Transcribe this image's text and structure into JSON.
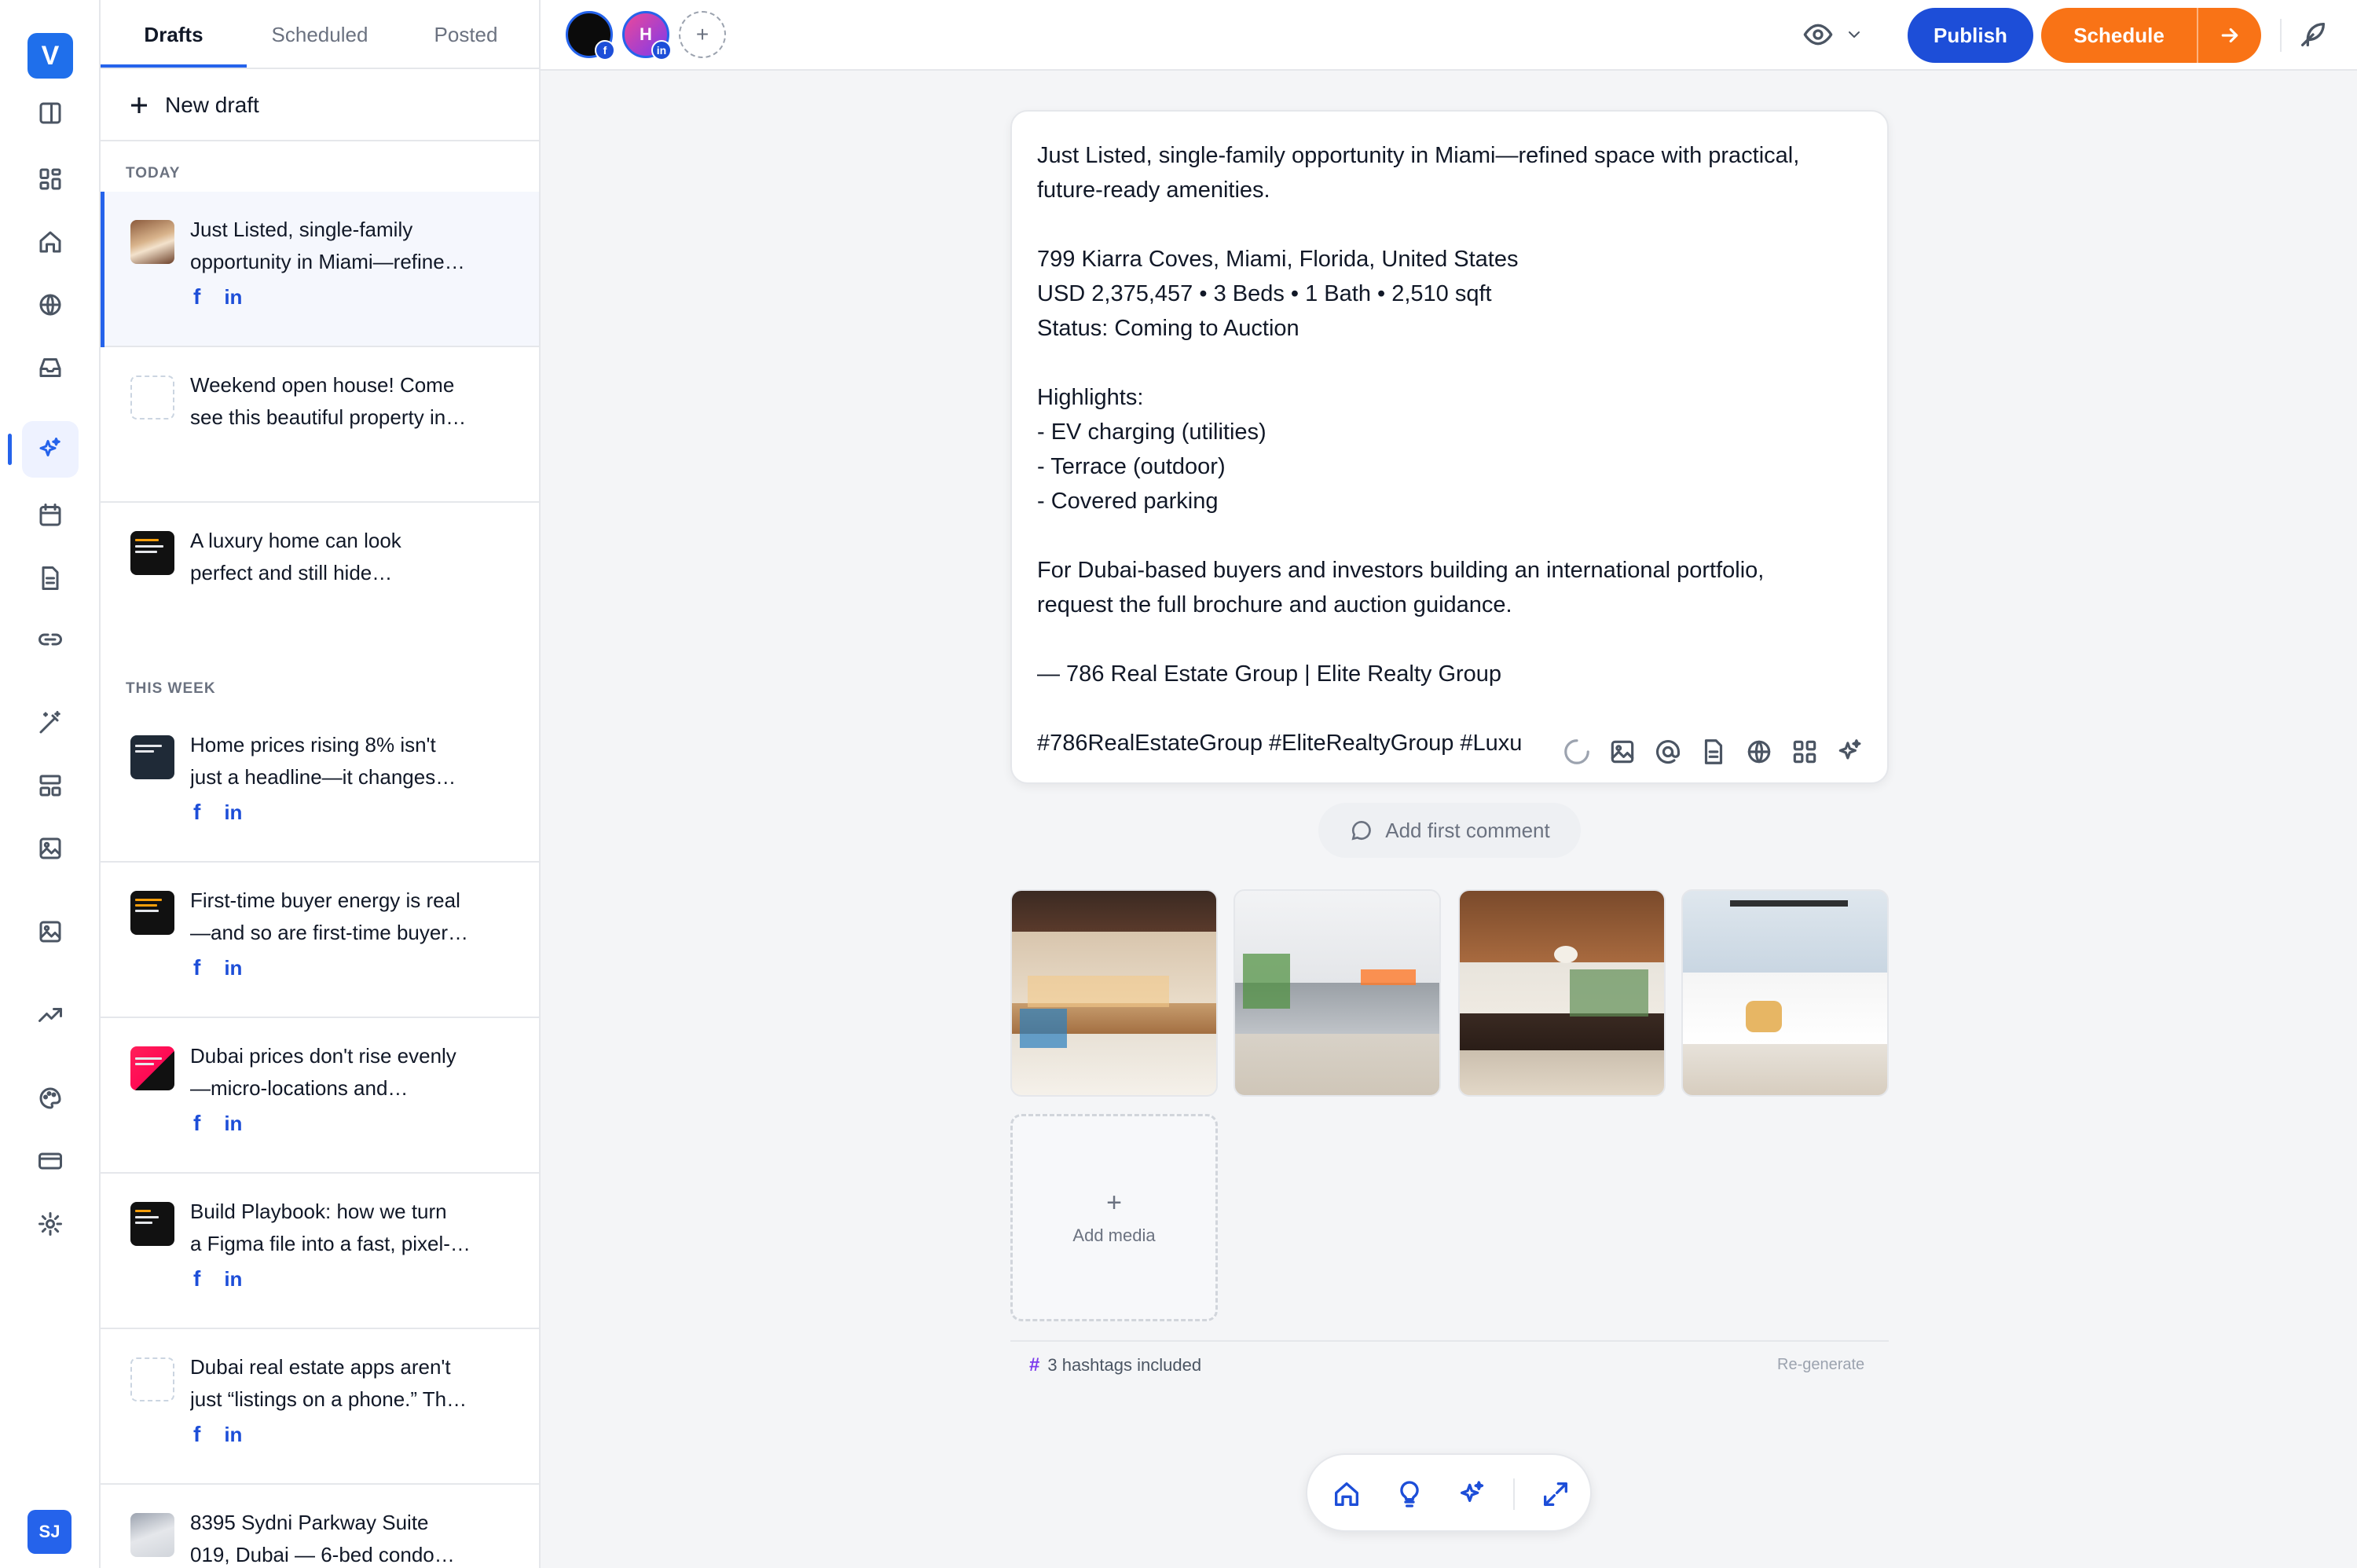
{
  "brand": {
    "logo_letter": "V",
    "accent": "#1d4ed8",
    "schedule_color": "#f97316"
  },
  "user": {
    "initials": "SJ"
  },
  "rail": {
    "icons": [
      "sidebar-toggle-icon",
      "dashboard-icon",
      "home-icon",
      "globe-icon",
      "inbox-icon",
      "sparkles-icon",
      "calendar-icon",
      "document-icon",
      "link-icon",
      "magic-wand-icon",
      "layout-icon",
      "image-icon",
      "media-library-icon",
      "trending-icon",
      "palette-icon",
      "credit-card-icon",
      "settings-icon"
    ],
    "active": "sparkles-icon"
  },
  "drafts_panel": {
    "tabs": [
      {
        "label": "Drafts",
        "active": true
      },
      {
        "label": "Scheduled",
        "active": false
      },
      {
        "label": "Posted",
        "active": false
      }
    ],
    "new_draft_label": "New draft",
    "sections": {
      "today": "TODAY",
      "this_week": "THIS WEEK"
    },
    "items": [
      {
        "line1": "Just Listed, single-family",
        "line2": "opportunity in Miami—refine…",
        "thumb": "photo",
        "socials": true,
        "selected": true
      },
      {
        "line1": "Weekend open house! Come",
        "line2": "see this beautiful property in…",
        "thumb": "empty",
        "socials": false
      },
      {
        "line1": "A luxury home can look",
        "line2": "perfect and still hide…",
        "thumb": "dark",
        "socials": false
      },
      {
        "line1": "Home prices rising 8% isn't",
        "line2": "just a headline—it changes…",
        "thumb": "navy",
        "socials": true
      },
      {
        "line1": "First-time buyer energy is real",
        "line2": "—and so are first-time buyer…",
        "thumb": "dark",
        "socials": true
      },
      {
        "line1": "Dubai prices don't rise evenly",
        "line2": "—micro-locations and…",
        "thumb": "pink",
        "socials": true
      },
      {
        "line1": "Build Playbook: how we turn",
        "line2": "a Figma file into a fast, pixel-…",
        "thumb": "dark",
        "socials": true
      },
      {
        "line1": "Dubai real estate apps aren't",
        "line2": "just “listings on a phone.” Th…",
        "thumb": "empty",
        "socials": true
      },
      {
        "line1": "8395 Sydni Parkway Suite",
        "line2": "019, Dubai — 6-bed condo…",
        "thumb": "photo2",
        "socials": false
      }
    ],
    "social_labels": {
      "facebook": "f",
      "linkedin": "in"
    }
  },
  "topbar": {
    "accounts": [
      {
        "initial": "",
        "network": "f"
      },
      {
        "initial": "H",
        "network": "in"
      }
    ],
    "add_account": "+",
    "publish_label": "Publish",
    "schedule_label": "Schedule"
  },
  "editor": {
    "lines": [
      "Just Listed, single-family opportunity in Miami—refined space with practical,",
      "future-ready amenities.",
      "",
      "799 Kiarra Coves, Miami, Florida, United States",
      "USD 2,375,457 • 3 Beds • 1 Bath • 2,510 sqft",
      "Status: Coming to Auction",
      "",
      "Highlights:",
      "- EV charging (utilities)",
      "- Terrace (outdoor)",
      "- Covered parking",
      "",
      "For Dubai-based buyers and investors building an international portfolio,",
      "request the full brochure and auction guidance.",
      "",
      "— 786 Real Estate Group | Elite Realty Group",
      "",
      "#786RealEstateGroup #EliteRealtyGroup #Luxu"
    ],
    "tools": [
      "loading-spinner-icon",
      "image-icon",
      "mention-icon",
      "document-icon",
      "globe-icon",
      "grid-icon",
      "sparkles-icon"
    ]
  },
  "comment": {
    "label": "Add first comment"
  },
  "media": {
    "images": [
      "kitchen-photo",
      "living-room-photo",
      "dining-room-photo",
      "bedroom-photo"
    ],
    "add_label": "Add media",
    "add_plus": "+"
  },
  "footer_meta": {
    "hash_symbol": "#",
    "hashtags_text": "3 hashtags included",
    "regenerate_label": "Re-generate"
  },
  "bottom_toolbar": {
    "icons": [
      "home-icon",
      "lightbulb-icon",
      "sparkles-icon",
      "expand-icon"
    ]
  }
}
